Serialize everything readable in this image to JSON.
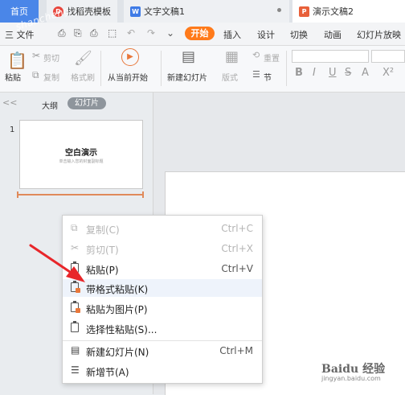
{
  "tabs": [
    {
      "label": "首页"
    },
    {
      "label": "找稻壳模板"
    },
    {
      "label": "文字文稿1"
    },
    {
      "label": "演示文稿2"
    }
  ],
  "menu": {
    "file": "三 文件",
    "start": "开始",
    "insert": "插入",
    "design": "设计",
    "switch": "切换",
    "animation": "动画",
    "slideshow": "幻灯片放映"
  },
  "ribbon": {
    "paste": "粘贴",
    "cut": "剪切",
    "copy": "复制",
    "format_painter": "格式刷",
    "from_current": "从当前开始",
    "new_slide": "新建幻灯片",
    "layout": "版式",
    "section": "节",
    "reset": "重置"
  },
  "left_panel": {
    "outline_tab": "大纲",
    "slides_tab": "幻灯片",
    "collapse": "<<",
    "slide_number": "1",
    "thumb_title": "空白演示",
    "thumb_subtitle": "单击输入您的封面副标题"
  },
  "context_menu": [
    {
      "label": "复制(C)",
      "shortcut": "Ctrl+C",
      "icon": "copy-icon",
      "enabled": false
    },
    {
      "label": "剪切(T)",
      "shortcut": "Ctrl+X",
      "icon": "scissors-icon",
      "enabled": false
    },
    {
      "label": "粘贴(P)",
      "shortcut": "Ctrl+V",
      "icon": "paste-icon",
      "enabled": true
    },
    {
      "label": "带格式粘贴(K)",
      "shortcut": "",
      "icon": "paste-format-icon",
      "enabled": true
    },
    {
      "label": "粘贴为图片(P)",
      "shortcut": "",
      "icon": "paste-image-icon",
      "enabled": true
    },
    {
      "label": "选择性粘贴(S)...",
      "shortcut": "",
      "icon": "paste-special-icon",
      "enabled": true
    },
    {
      "label": "新建幻灯片(N)",
      "shortcut": "Ctrl+M",
      "icon": "new-slide-icon",
      "enabled": true
    },
    {
      "label": "新增节(A)",
      "shortcut": "",
      "icon": "new-section-icon",
      "enabled": true
    }
  ],
  "watermark": {
    "top_left": "shancheng",
    "bottom_right_1": "Baidu 经验",
    "bottom_right_2": "jingyan.baidu.com"
  },
  "colors": {
    "accent_orange": "#ff7a1a",
    "home_tab": "#4a86e8",
    "arrow": "#e8262a"
  }
}
